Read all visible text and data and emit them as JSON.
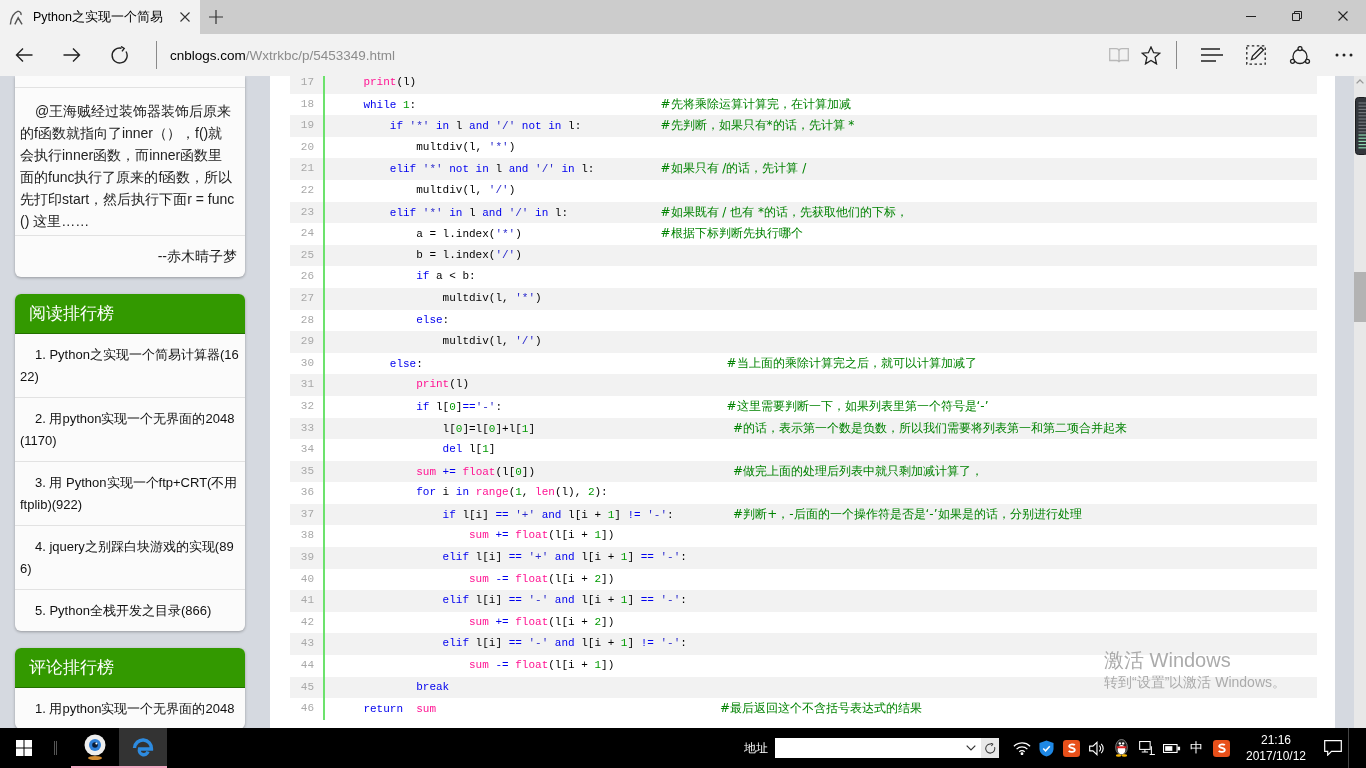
{
  "browser": {
    "tab": {
      "title": "Python之实现一个简易",
      "selected": true
    },
    "address": {
      "host": "cnblogs.com",
      "path": "/Wxtrkbc/p/5453349.html"
    },
    "page_actions": [
      {
        "kind": "reading",
        "disabled": true
      },
      {
        "kind": "favorite",
        "disabled": false
      }
    ],
    "tools": [
      {
        "kind": "hub",
        "disabled": false
      },
      {
        "kind": "note",
        "disabled": false
      },
      {
        "kind": "share",
        "disabled": false
      },
      {
        "kind": "more",
        "disabled": false
      }
    ]
  },
  "sidebar": {
    "comment": {
      "text": "@王海贼经过装饰器装饰后原来的f函数就指向了inner（），f()就会执行inner函数，而inner函数里面的func执行了原来的f函数，所以先打印start，然后执行下面r = func() 这里……",
      "author": "--赤木晴子梦"
    },
    "panels": [
      {
        "title": "阅读排行榜",
        "items": [
          "1. Python之实现一个简易计算器(1622)",
          "2. 用python实现一个无界面的2048(1170)",
          "3. 用 Python实现一个ftp+CRT(不用ftplib)(922)",
          "4. jquery之别踩白块游戏的实现(896)",
          "5. Python全栈开发之目录(866)"
        ]
      },
      {
        "title": "评论排行榜",
        "items": [
          "1. 用python实现一个无界面的2048"
        ]
      }
    ]
  },
  "code": {
    "lines": [
      {
        "number": "17",
        "tokens": [
          {
            "kind": "builtin",
            "text": "print"
          },
          {
            "kind": "plain",
            "text": "(l)"
          }
        ]
      },
      {
        "number": "18",
        "tokens": [
          {
            "kind": "keyword",
            "text": "while"
          },
          {
            "kind": "number",
            "text": " 1"
          },
          {
            "kind": "plain",
            "text": ":"
          }
        ],
        "comment": "                                     #先将乘除运算计算完，在计算加减",
        "children": [
          {
            "number": "19",
            "tokens": [
              {
                "kind": "keyword",
                "text": "if"
              },
              {
                "kind": "string",
                "text": " '*'"
              },
              {
                "kind": "keyword",
                "text": " in"
              },
              {
                "kind": "plain",
                "text": " l "
              },
              {
                "kind": "keyword",
                "text": "and"
              },
              {
                "kind": "string",
                "text": " '/'"
              },
              {
                "kind": "keyword",
                "text": " not in"
              },
              {
                "kind": "plain",
                "text": " l:"
              }
            ],
            "comment": "            #先判断，如果只有*的话，先计算 *",
            "children": [
              {
                "number": "20",
                "tokens": [
                  {
                    "kind": "plain",
                    "text": "multdiv(l, "
                  },
                  {
                    "kind": "string",
                    "text": "'*'"
                  },
                  {
                    "kind": "plain",
                    "text": ")"
                  }
                ]
              }
            ]
          },
          {
            "number": "21",
            "tokens": [
              {
                "kind": "keyword",
                "text": "elif"
              },
              {
                "kind": "string",
                "text": " '*'"
              },
              {
                "kind": "keyword",
                "text": " not in"
              },
              {
                "kind": "plain",
                "text": " l "
              },
              {
                "kind": "keyword",
                "text": "and"
              },
              {
                "kind": "string",
                "text": " '/'"
              },
              {
                "kind": "keyword",
                "text": " in"
              },
              {
                "kind": "plain",
                "text": " l:"
              }
            ],
            "comment": "          #如果只有 /的话，先计算 /",
            "children": [
              {
                "number": "22",
                "tokens": [
                  {
                    "kind": "plain",
                    "text": "multdiv(l, "
                  },
                  {
                    "kind": "string",
                    "text": "'/'"
                  },
                  {
                    "kind": "plain",
                    "text": ")"
                  }
                ]
              }
            ]
          },
          {
            "number": "23",
            "tokens": [
              {
                "kind": "keyword",
                "text": "elif"
              },
              {
                "kind": "string",
                "text": " '*'"
              },
              {
                "kind": "keyword",
                "text": " in"
              },
              {
                "kind": "plain",
                "text": " l "
              },
              {
                "kind": "keyword",
                "text": "and"
              },
              {
                "kind": "string",
                "text": " '/'"
              },
              {
                "kind": "keyword",
                "text": " in"
              },
              {
                "kind": "plain",
                "text": " l:"
              }
            ],
            "comment": "              #如果既有 / 也有 *的话，先获取他们的下标，",
            "children": [
              {
                "number": "24",
                "tokens": [
                  {
                    "kind": "plain",
                    "text": "a = l.index("
                  },
                  {
                    "kind": "string",
                    "text": "'*'"
                  },
                  {
                    "kind": "plain",
                    "text": ")"
                  }
                ],
                "comment": "                     #根据下标判断先执行哪个"
              },
              {
                "number": "25",
                "tokens": [
                  {
                    "kind": "plain",
                    "text": "b = l.index("
                  },
                  {
                    "kind": "string",
                    "text": "'/'"
                  },
                  {
                    "kind": "plain",
                    "text": ")"
                  }
                ]
              },
              {
                "number": "26",
                "tokens": [
                  {
                    "kind": "keyword",
                    "text": "if"
                  },
                  {
                    "kind": "plain",
                    "text": " a < b:"
                  }
                ],
                "children": [
                  {
                    "number": "27",
                    "tokens": [
                      {
                        "kind": "plain",
                        "text": "multdiv(l, "
                      },
                      {
                        "kind": "string",
                        "text": "'*'"
                      },
                      {
                        "kind": "plain",
                        "text": ")"
                      }
                    ]
                  }
                ]
              },
              {
                "number": "28",
                "tokens": [
                  {
                    "kind": "keyword",
                    "text": "else"
                  },
                  {
                    "kind": "plain",
                    "text": ":"
                  }
                ],
                "children": [
                  {
                    "number": "29",
                    "tokens": [
                      {
                        "kind": "plain",
                        "text": "multdiv(l, "
                      },
                      {
                        "kind": "string",
                        "text": "'/'"
                      },
                      {
                        "kind": "plain",
                        "text": ")"
                      }
                    ]
                  }
                ]
              }
            ]
          },
          {
            "number": "30",
            "tokens": [
              {
                "kind": "keyword",
                "text": "else"
              },
              {
                "kind": "plain",
                "text": ":"
              }
            ],
            "comment": "                                              #当上面的乘除计算完之后，就可以计算加减了",
            "children": [
              {
                "number": "31",
                "tokens": [
                  {
                    "kind": "builtin",
                    "text": "print"
                  },
                  {
                    "kind": "plain",
                    "text": "(l)"
                  }
                ]
              },
              {
                "number": "32",
                "tokens": [
                  {
                    "kind": "keyword",
                    "text": "if"
                  },
                  {
                    "kind": "plain",
                    "text": " l["
                  },
                  {
                    "kind": "number",
                    "text": "0"
                  },
                  {
                    "kind": "plain",
                    "text": "]"
                  },
                  {
                    "kind": "operator",
                    "text": "=="
                  },
                  {
                    "kind": "string",
                    "text": "'-'"
                  },
                  {
                    "kind": "plain",
                    "text": ":"
                  }
                ],
                "comment": "                                  #这里需要判断一下，如果列表里第一个符号是‘-’",
                "children": [
                  {
                    "number": "33",
                    "tokens": [
                      {
                        "kind": "plain",
                        "text": "l["
                      },
                      {
                        "kind": "number",
                        "text": "0"
                      },
                      {
                        "kind": "plain",
                        "text": "]=l["
                      },
                      {
                        "kind": "number",
                        "text": "0"
                      },
                      {
                        "kind": "plain",
                        "text": "]+l["
                      },
                      {
                        "kind": "number",
                        "text": "1"
                      },
                      {
                        "kind": "plain",
                        "text": "]"
                      }
                    ],
                    "comment": "                              #的话，表示第一个数是负数，所以我们需要将列表第一和第二项合并起来"
                  },
                  {
                    "number": "34",
                    "tokens": [
                      {
                        "kind": "keyword",
                        "text": "del"
                      },
                      {
                        "kind": "plain",
                        "text": " l["
                      },
                      {
                        "kind": "number",
                        "text": "1"
                      },
                      {
                        "kind": "plain",
                        "text": "]"
                      }
                    ]
                  }
                ]
              },
              {
                "number": "35",
                "tokens": [
                  {
                    "kind": "builtin",
                    "text": "sum"
                  },
                  {
                    "kind": "operator",
                    "text": " +="
                  },
                  {
                    "kind": "builtin",
                    "text": " float"
                  },
                  {
                    "kind": "plain",
                    "text": "(l["
                  },
                  {
                    "kind": "number",
                    "text": "0"
                  },
                  {
                    "kind": "plain",
                    "text": "])"
                  }
                ],
                "comment": "                              #做完上面的处理后列表中就只剩加减计算了，"
              },
              {
                "number": "36",
                "tokens": [
                  {
                    "kind": "keyword",
                    "text": "for"
                  },
                  {
                    "kind": "plain",
                    "text": " i "
                  },
                  {
                    "kind": "keyword",
                    "text": "in"
                  },
                  {
                    "kind": "builtin",
                    "text": " range"
                  },
                  {
                    "kind": "plain",
                    "text": "("
                  },
                  {
                    "kind": "number",
                    "text": "1"
                  },
                  {
                    "kind": "plain",
                    "text": ", "
                  },
                  {
                    "kind": "builtin",
                    "text": "len"
                  },
                  {
                    "kind": "plain",
                    "text": "(l), "
                  },
                  {
                    "kind": "number",
                    "text": "2"
                  },
                  {
                    "kind": "plain",
                    "text": "):"
                  }
                ],
                "children": [
                  {
                    "number": "37",
                    "tokens": [
                      {
                        "kind": "keyword",
                        "text": "if"
                      },
                      {
                        "kind": "plain",
                        "text": " l[i] "
                      },
                      {
                        "kind": "operator",
                        "text": "=="
                      },
                      {
                        "kind": "string",
                        "text": " '+'"
                      },
                      {
                        "kind": "keyword",
                        "text": " and"
                      },
                      {
                        "kind": "plain",
                        "text": " l[i + "
                      },
                      {
                        "kind": "number",
                        "text": "1"
                      },
                      {
                        "kind": "plain",
                        "text": "] "
                      },
                      {
                        "kind": "operator",
                        "text": "!="
                      },
                      {
                        "kind": "string",
                        "text": " '-'"
                      },
                      {
                        "kind": "plain",
                        "text": ":"
                      }
                    ],
                    "comment": "         #判断+，-后面的一个操作符是否是‘-’如果是的话，分别进行处理",
                    "children": [
                      {
                        "number": "38",
                        "tokens": [
                          {
                            "kind": "builtin",
                            "text": "sum"
                          },
                          {
                            "kind": "operator",
                            "text": " +="
                          },
                          {
                            "kind": "builtin",
                            "text": " float"
                          },
                          {
                            "kind": "plain",
                            "text": "(l[i + "
                          },
                          {
                            "kind": "number",
                            "text": "1"
                          },
                          {
                            "kind": "plain",
                            "text": "])"
                          }
                        ]
                      }
                    ]
                  },
                  {
                    "number": "39",
                    "tokens": [
                      {
                        "kind": "keyword",
                        "text": "elif"
                      },
                      {
                        "kind": "plain",
                        "text": " l[i] "
                      },
                      {
                        "kind": "operator",
                        "text": "=="
                      },
                      {
                        "kind": "string",
                        "text": " '+'"
                      },
                      {
                        "kind": "keyword",
                        "text": " and"
                      },
                      {
                        "kind": "plain",
                        "text": " l[i + "
                      },
                      {
                        "kind": "number",
                        "text": "1"
                      },
                      {
                        "kind": "plain",
                        "text": "] "
                      },
                      {
                        "kind": "operator",
                        "text": "=="
                      },
                      {
                        "kind": "string",
                        "text": " '-'"
                      },
                      {
                        "kind": "plain",
                        "text": ":"
                      }
                    ],
                    "children": [
                      {
                        "number": "40",
                        "tokens": [
                          {
                            "kind": "builtin",
                            "text": "sum"
                          },
                          {
                            "kind": "operator",
                            "text": " -="
                          },
                          {
                            "kind": "builtin",
                            "text": " float"
                          },
                          {
                            "kind": "plain",
                            "text": "(l[i + "
                          },
                          {
                            "kind": "number",
                            "text": "2"
                          },
                          {
                            "kind": "plain",
                            "text": "])"
                          }
                        ]
                      }
                    ]
                  },
                  {
                    "number": "41",
                    "tokens": [
                      {
                        "kind": "keyword",
                        "text": "elif"
                      },
                      {
                        "kind": "plain",
                        "text": " l[i] "
                      },
                      {
                        "kind": "operator",
                        "text": "=="
                      },
                      {
                        "kind": "string",
                        "text": " '-'"
                      },
                      {
                        "kind": "keyword",
                        "text": " and"
                      },
                      {
                        "kind": "plain",
                        "text": " l[i + "
                      },
                      {
                        "kind": "number",
                        "text": "1"
                      },
                      {
                        "kind": "plain",
                        "text": "] "
                      },
                      {
                        "kind": "operator",
                        "text": "=="
                      },
                      {
                        "kind": "string",
                        "text": " '-'"
                      },
                      {
                        "kind": "plain",
                        "text": ":"
                      }
                    ],
                    "children": [
                      {
                        "number": "42",
                        "tokens": [
                          {
                            "kind": "builtin",
                            "text": "sum"
                          },
                          {
                            "kind": "operator",
                            "text": " +="
                          },
                          {
                            "kind": "builtin",
                            "text": " float"
                          },
                          {
                            "kind": "plain",
                            "text": "(l[i + "
                          },
                          {
                            "kind": "number",
                            "text": "2"
                          },
                          {
                            "kind": "plain",
                            "text": "])"
                          }
                        ]
                      }
                    ]
                  },
                  {
                    "number": "43",
                    "tokens": [
                      {
                        "kind": "keyword",
                        "text": "elif"
                      },
                      {
                        "kind": "plain",
                        "text": " l[i] "
                      },
                      {
                        "kind": "operator",
                        "text": "=="
                      },
                      {
                        "kind": "string",
                        "text": " '-'"
                      },
                      {
                        "kind": "keyword",
                        "text": " and"
                      },
                      {
                        "kind": "plain",
                        "text": " l[i + "
                      },
                      {
                        "kind": "number",
                        "text": "1"
                      },
                      {
                        "kind": "plain",
                        "text": "] "
                      },
                      {
                        "kind": "operator",
                        "text": "!="
                      },
                      {
                        "kind": "string",
                        "text": " '-'"
                      },
                      {
                        "kind": "plain",
                        "text": ":"
                      }
                    ],
                    "children": [
                      {
                        "number": "44",
                        "tokens": [
                          {
                            "kind": "builtin",
                            "text": "sum"
                          },
                          {
                            "kind": "operator",
                            "text": " -="
                          },
                          {
                            "kind": "builtin",
                            "text": " float"
                          },
                          {
                            "kind": "plain",
                            "text": "(l[i + "
                          },
                          {
                            "kind": "number",
                            "text": "1"
                          },
                          {
                            "kind": "plain",
                            "text": "])"
                          }
                        ]
                      }
                    ]
                  }
                ]
              },
              {
                "number": "45",
                "tokens": [
                  {
                    "kind": "keyword",
                    "text": "break"
                  }
                ]
              }
            ]
          }
        ]
      },
      {
        "number": "46",
        "tokens": [
          {
            "kind": "keyword",
            "text": "return"
          },
          {
            "kind": "builtin",
            "text": "  sum"
          }
        ],
        "comment": "                                           #最后返回这个不含括号表达式的结果"
      }
    ]
  },
  "activation_notice": {
    "title": "激活 Windows",
    "text": "转到“设置”以激活 Windows。"
  },
  "taskbar": {
    "apps": [
      {
        "kind": "webcam",
        "selected": false
      },
      {
        "kind": "edge",
        "selected": true
      }
    ],
    "address_label": "地址",
    "tray": [
      {
        "kind": "wifi"
      },
      {
        "kind": "shield"
      },
      {
        "kind": "s-logo"
      },
      {
        "kind": "volume"
      },
      {
        "kind": "penguin"
      },
      {
        "kind": "network"
      },
      {
        "kind": "battery"
      },
      {
        "kind": "ime",
        "label": "中"
      },
      {
        "kind": "s-logo"
      }
    ],
    "time": "21:16",
    "date": "2017/10/12"
  }
}
